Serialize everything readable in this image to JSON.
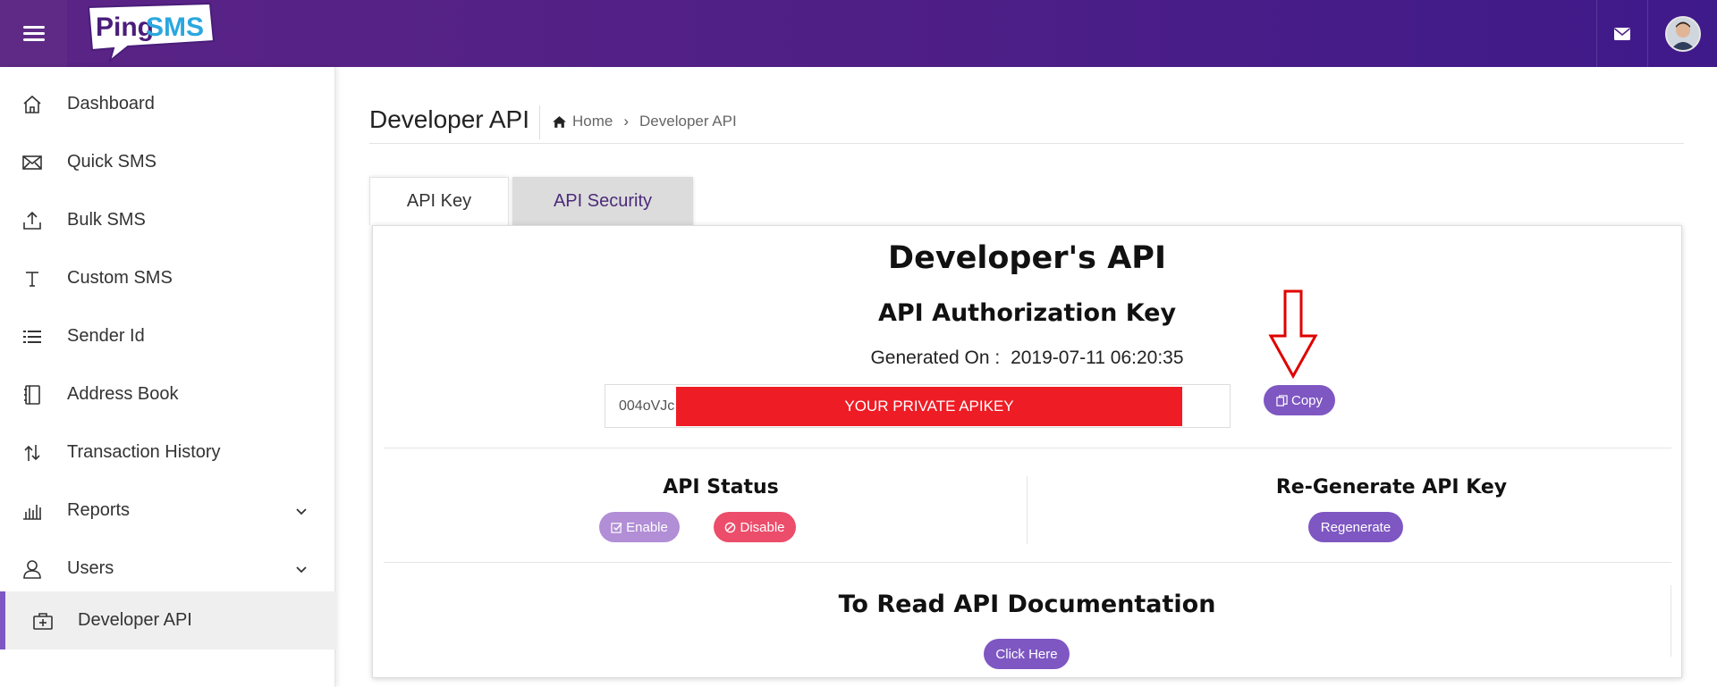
{
  "app": {
    "logo_text_ping": "Ping",
    "logo_text_sms": "SMS"
  },
  "topbar": {
    "icons": [
      "menu-icon",
      "mail-icon",
      "avatar"
    ]
  },
  "sidebar": {
    "items": [
      {
        "label": "Dashboard",
        "icon": "home-icon"
      },
      {
        "label": "Quick SMS",
        "icon": "envelope-icon"
      },
      {
        "label": "Bulk SMS",
        "icon": "upload-icon"
      },
      {
        "label": "Custom SMS",
        "icon": "text-t-icon"
      },
      {
        "label": "Sender Id",
        "icon": "list-icon"
      },
      {
        "label": "Address Book",
        "icon": "address-book-icon"
      },
      {
        "label": "Transaction History",
        "icon": "transfer-arrows-icon"
      },
      {
        "label": "Reports",
        "icon": "bar-chart-icon",
        "has_children": true
      },
      {
        "label": "Users",
        "icon": "user-icon",
        "has_children": true
      },
      {
        "label": "Developer API",
        "icon": "medical-bag-icon",
        "active": true
      }
    ],
    "accent_color": "#7e57c2"
  },
  "page": {
    "title": "Developer API",
    "breadcrumb": [
      "Home",
      "Developer API"
    ]
  },
  "tabs": [
    {
      "label": "API Key",
      "active": true
    },
    {
      "label": "API Security",
      "active": false
    }
  ],
  "panel": {
    "heading": "Developer's API",
    "subheading": "API Authorization Key",
    "generated_label": "Generated On :",
    "generated_value": "2019-07-11 06:20:35",
    "api_key_visible": "004oVJc",
    "redaction_text": "YOUR PRIVATE APIKEY",
    "copy_label": "Copy",
    "status_heading": "API Status",
    "enable_label": "Enable",
    "disable_label": "Disable",
    "regen_heading": "Re-Generate API Key",
    "regen_label": "Regenerate",
    "doc_heading": "To Read API Documentation",
    "doc_button_label": "Click Here"
  },
  "colors": {
    "topbar_start": "#5b2486",
    "topbar_end": "#3f1a8a",
    "primary_button": "#7e57c2",
    "enable_button": "#b18ed6",
    "disable_button": "#ec4d6b",
    "redaction": "#ee1c25",
    "annotation_arrow": "#e00000"
  }
}
